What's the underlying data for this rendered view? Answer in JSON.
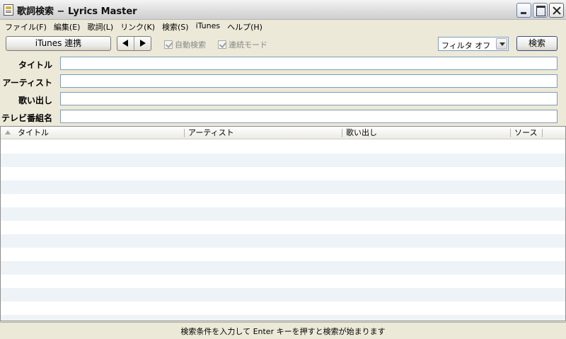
{
  "window": {
    "title": "歌詞検索 − Lyrics Master"
  },
  "menu": [
    "ファイル(F)",
    "編集(E)",
    "歌詞(L)",
    "リンク(K)",
    "検索(S)",
    "iTunes",
    "ヘルプ(H)"
  ],
  "toolbar": {
    "itunes_label": "iTunes 連携",
    "auto_search_label": "自動検索",
    "continuous_mode_label": "連続モード",
    "filter_value": "フィルタ オフ",
    "search_label": "検索"
  },
  "fields": {
    "title_label": "タイトル",
    "artist_label": "アーティスト",
    "lyrics_label": "歌い出し",
    "tv_label": "テレビ番組名",
    "title_value": "",
    "artist_value": "",
    "lyrics_value": "",
    "tv_value": ""
  },
  "list": {
    "columns": [
      "タイトル",
      "アーティスト",
      "歌い出し",
      "ソース"
    ]
  },
  "status": {
    "text": "検索条件を入力して Enter キーを押すと検索が始まります"
  }
}
